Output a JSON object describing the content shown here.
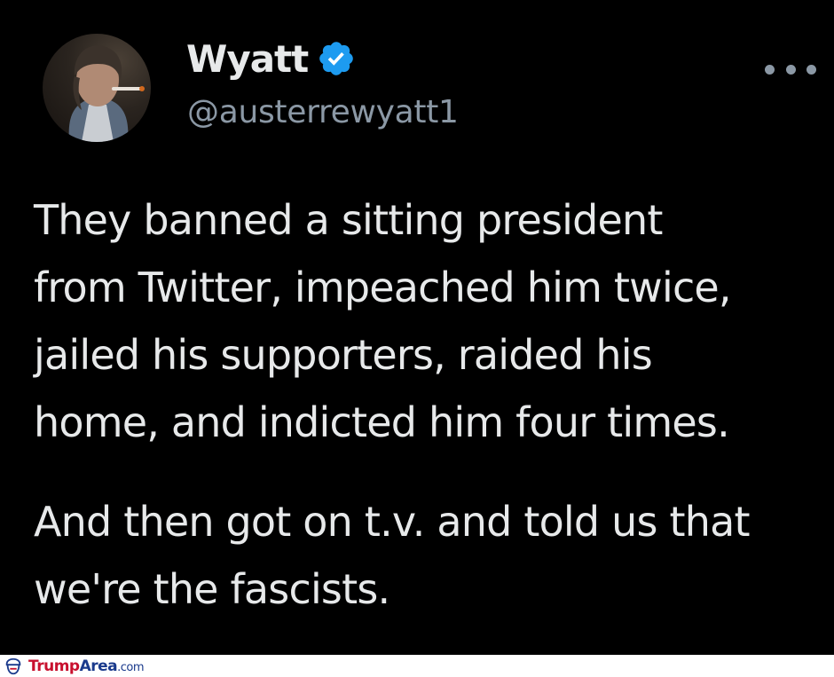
{
  "tweet": {
    "author": {
      "name": "Wyatt",
      "handle": "@austerrewyatt1",
      "verified": true,
      "avatar_icon": "profile-photo-avatar",
      "verified_icon": "verified-badge-icon"
    },
    "menu_icon": "more-options-icon",
    "text": {
      "paragraph1": "They banned a sitting president\nfrom Twitter, impeached him twice,\njailed his supporters, raided his\nhome, and indicted him four times.",
      "paragraph2": "And then got on t.v. and told us that\nwe're the fascists."
    },
    "colors": {
      "background": "#000000",
      "text": "#e7e9ea",
      "secondary": "#8b98a5",
      "verified": "#1d9bf0"
    }
  },
  "watermark": {
    "part1": "Trump",
    "part2": "Area",
    "part3": ".com",
    "icon": "logo-icon"
  }
}
